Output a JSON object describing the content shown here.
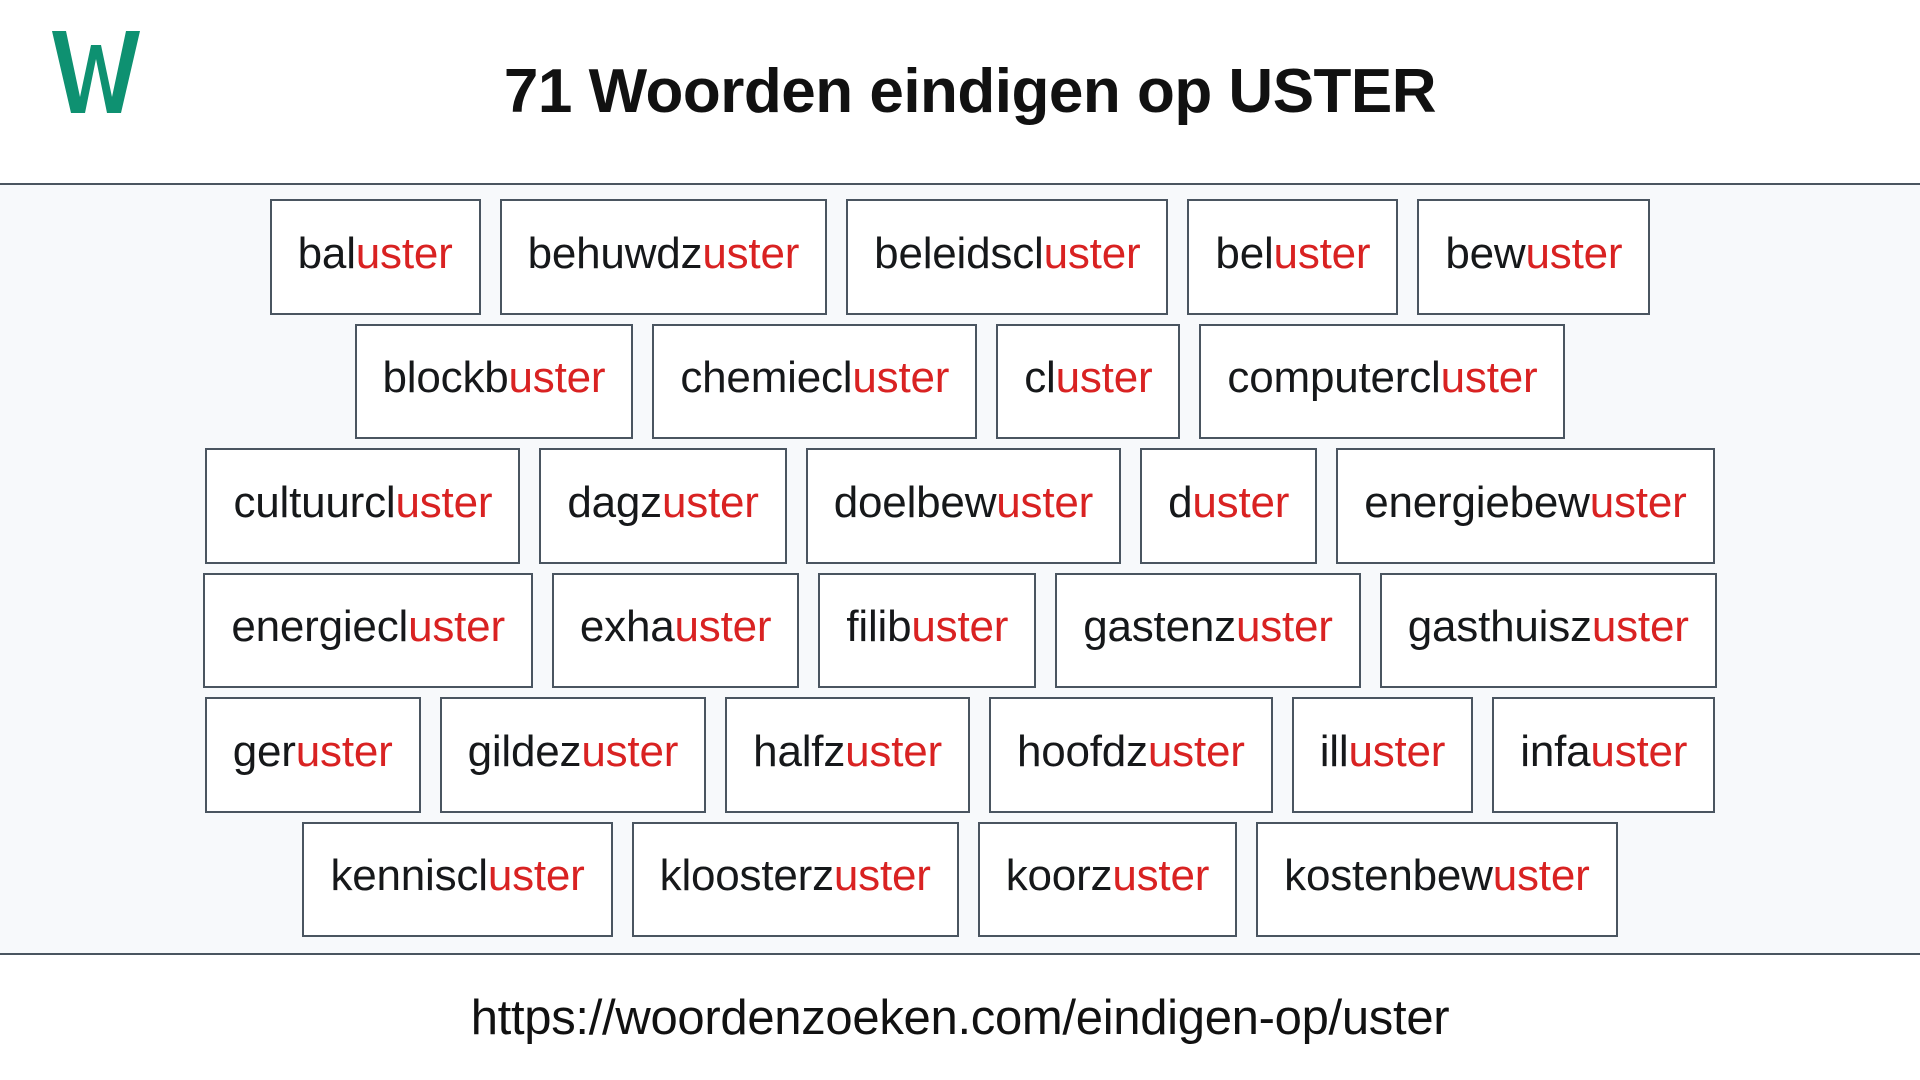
{
  "header": {
    "logo_icon": "w-logo-icon",
    "logo_letter": "W",
    "logo_color": "#0e9171",
    "title": "71 Woorden eindigen op USTER"
  },
  "theme": {
    "suffix_color": "#d92222",
    "stem_color": "#16181a",
    "border_color": "#4a5560",
    "panel_background": "#f7f9fb",
    "page_background": "#ffffff"
  },
  "main": {
    "suffix": "uster",
    "word_count": 71,
    "rows": [
      [
        {
          "stem": "bal",
          "suffix": "uster",
          "word": "baluster"
        },
        {
          "stem": "behuwdz",
          "suffix": "uster",
          "word": "behuwdzuster"
        },
        {
          "stem": "beleidscl",
          "suffix": "uster",
          "word": "beleidscluster"
        },
        {
          "stem": "bel",
          "suffix": "uster",
          "word": "beluster"
        },
        {
          "stem": "bew",
          "suffix": "uster",
          "word": "bewuster"
        }
      ],
      [
        {
          "stem": "blockb",
          "suffix": "uster",
          "word": "blockbuster"
        },
        {
          "stem": "chemiecl",
          "suffix": "uster",
          "word": "chemiecluster"
        },
        {
          "stem": "cl",
          "suffix": "uster",
          "word": "cluster"
        },
        {
          "stem": "computercl",
          "suffix": "uster",
          "word": "computercluster"
        }
      ],
      [
        {
          "stem": "cultuurcl",
          "suffix": "uster",
          "word": "cultuurcluster"
        },
        {
          "stem": "dagz",
          "suffix": "uster",
          "word": "dagzuster"
        },
        {
          "stem": "doelbew",
          "suffix": "uster",
          "word": "doelbewuster"
        },
        {
          "stem": "d",
          "suffix": "uster",
          "word": "duster"
        },
        {
          "stem": "energiebew",
          "suffix": "uster",
          "word": "energiebewuster"
        }
      ],
      [
        {
          "stem": "energiecl",
          "suffix": "uster",
          "word": "energiecluster"
        },
        {
          "stem": "exha",
          "suffix": "uster",
          "word": "exhauster"
        },
        {
          "stem": "filib",
          "suffix": "uster",
          "word": "filibuster"
        },
        {
          "stem": "gastenz",
          "suffix": "uster",
          "word": "gastenzuster"
        },
        {
          "stem": "gasthuisz",
          "suffix": "uster",
          "word": "gasthuiszuster"
        }
      ],
      [
        {
          "stem": "ger",
          "suffix": "uster",
          "word": "geruster"
        },
        {
          "stem": "gildez",
          "suffix": "uster",
          "word": "gildezuster"
        },
        {
          "stem": "halfz",
          "suffix": "uster",
          "word": "halfzuster"
        },
        {
          "stem": "hoofdz",
          "suffix": "uster",
          "word": "hoofdzuster"
        },
        {
          "stem": "ill",
          "suffix": "uster",
          "word": "illuster"
        },
        {
          "stem": "infa",
          "suffix": "uster",
          "word": "infauster"
        }
      ],
      [
        {
          "stem": "kenniscl",
          "suffix": "uster",
          "word": "kenniscluster"
        },
        {
          "stem": "kloosterz",
          "suffix": "uster",
          "word": "kloosterzuster"
        },
        {
          "stem": "koorz",
          "suffix": "uster",
          "word": "koorzuster"
        },
        {
          "stem": "kostenbew",
          "suffix": "uster",
          "word": "kostenbewuster"
        }
      ]
    ]
  },
  "footer": {
    "url": "https://woordenzoeken.com/eindigen-op/uster"
  }
}
